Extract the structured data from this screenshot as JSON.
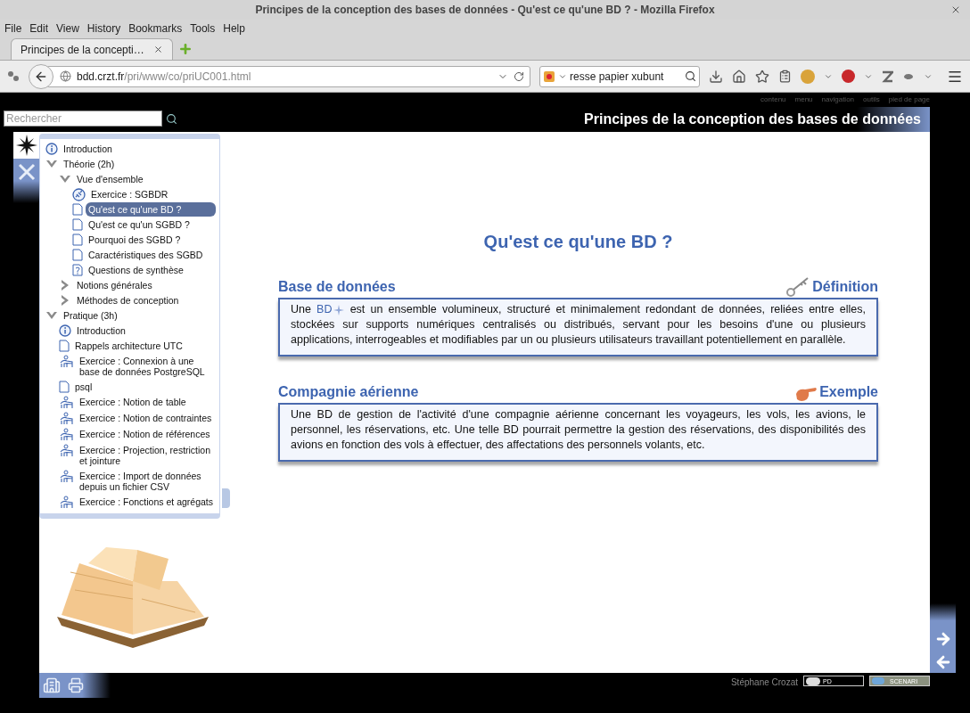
{
  "window": {
    "title": "Principes de la conception des bases de données - Qu'est ce qu'une BD ? - Mozilla Firefox"
  },
  "menu": [
    "File",
    "Edit",
    "View",
    "History",
    "Bookmarks",
    "Tools",
    "Help"
  ],
  "tabs": [
    {
      "label": "Principes de la concepti…",
      "selected": true
    }
  ],
  "address": {
    "host": "bdd.crzt.fr",
    "path": "/pri/www/co/priUC001.html"
  },
  "search_box": {
    "value": "resse papier xubunt"
  },
  "page": {
    "top_links": [
      "contenu",
      "menu",
      "navigation",
      "outils",
      "pied de page"
    ],
    "search": {
      "placeholder": "Rechercher"
    },
    "site_title": "Principes de la conception des bases de données",
    "tree": [
      {
        "label": "Introduction",
        "kind": "info",
        "selected": false
      },
      {
        "label": "Théorie (2h)",
        "kind": "section",
        "expanded": true,
        "selected": false,
        "children": [
          {
            "label": "Vue d'ensemble",
            "kind": "section",
            "expanded": true,
            "selected": false,
            "children": [
              {
                "label": "Exercice : SGBDR",
                "kind": "link-exercise",
                "selected": false
              },
              {
                "label": "Qu'est ce qu'une BD ?",
                "kind": "page",
                "selected": true
              },
              {
                "label": "Qu'est ce qu'un SGBD ?",
                "kind": "page",
                "selected": false
              },
              {
                "label": "Pourquoi des SGBD ?",
                "kind": "page",
                "selected": false
              },
              {
                "label": "Caractéristiques des SGBD",
                "kind": "page",
                "selected": false
              },
              {
                "label": "Questions de synthèse",
                "kind": "quiz",
                "selected": false
              }
            ]
          },
          {
            "label": "Notions générales",
            "kind": "section",
            "expanded": false,
            "selected": false
          },
          {
            "label": "Méthodes de conception",
            "kind": "section",
            "expanded": false,
            "selected": false
          }
        ]
      },
      {
        "label": "Pratique (3h)",
        "kind": "section",
        "expanded": true,
        "selected": false,
        "children": [
          {
            "label": "Introduction",
            "kind": "info",
            "selected": false
          },
          {
            "label": "Rappels architecture UTC",
            "kind": "page",
            "selected": false
          },
          {
            "label": "Exercice : Connexion à une base de données PostgreSQL",
            "kind": "exercise",
            "selected": false
          },
          {
            "label": "psql",
            "kind": "page",
            "selected": false
          },
          {
            "label": "Exercice : Notion de table",
            "kind": "exercise",
            "selected": false
          },
          {
            "label": "Exercice : Notion de contraintes",
            "kind": "exercise",
            "selected": false
          },
          {
            "label": "Exercice : Notion de références",
            "kind": "exercise",
            "selected": false
          },
          {
            "label": "Exercice : Projection, restriction et jointure",
            "kind": "exercise",
            "selected": false
          },
          {
            "label": "Exercice : Import de données depuis un fichier CSV",
            "kind": "exercise",
            "selected": false
          },
          {
            "label": "Exercice : Fonctions et agrégats",
            "kind": "exercise",
            "selected": false
          }
        ]
      }
    ],
    "heading": "Qu'est ce qu'une BD ?",
    "blocks": [
      {
        "title": "Base de données",
        "kind": "definition",
        "label": "Définition",
        "text_before": "Une",
        "link": "BD",
        "text_after": "est un ensemble volumineux, structuré et minimalement redondant de données, reliées entre elles, stockées sur supports numériques centralisés ou distribués, servant pour les besoins d'une ou plusieurs applications, interrogeables et modifiables par un ou plusieurs utilisateurs travaillant potentiellement en parallèle."
      },
      {
        "title": "Compagnie aérienne",
        "kind": "example",
        "label": "Exemple",
        "text_before": "Une BD de gestion de l'activité d'une compagnie aérienne concernant les voyageurs, les vols, les avions, le personnel, les réservations, etc. Une telle BD pourrait permettre la gestion des réservations, des disponibilités des avions en fonction des vols à effectuer, des affectations des personnels volants, etc."
      }
    ],
    "footer": {
      "author": "Stéphane Crozat",
      "license": "PD",
      "brand": "SCENARI"
    }
  }
}
